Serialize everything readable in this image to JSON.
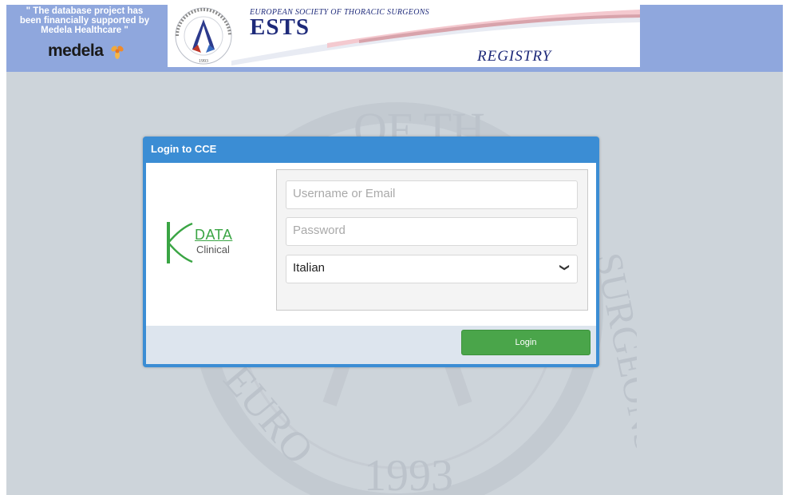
{
  "sponsor": {
    "lines": [
      "\" The database project has",
      "been financially supported by",
      "Medela Healthcare \""
    ],
    "brand": "medela"
  },
  "banner": {
    "society": "EUROPEAN SOCIETY OF THORACIC SURGEONS",
    "acronym": "ESTS",
    "registry": "REGISTRY",
    "seal_top": "SOCIETY OF THORACIC SURGEONS",
    "seal_year": "1993"
  },
  "watermark": {
    "text_top": "OF TH",
    "text_right": "SURGEONS",
    "text_left": "EURO",
    "year": "1993"
  },
  "login": {
    "title": "Login to CCE",
    "logo_data": "DATA",
    "logo_clinical": "Clinical",
    "username_placeholder": "Username or Email",
    "password_placeholder": "Password",
    "language": "Italian",
    "login_label": "Login"
  },
  "colors": {
    "header": "#8fa7dd",
    "panel": "#3b8dd4",
    "button": "#4aa54a",
    "brand_navy": "#1e2a7a"
  }
}
